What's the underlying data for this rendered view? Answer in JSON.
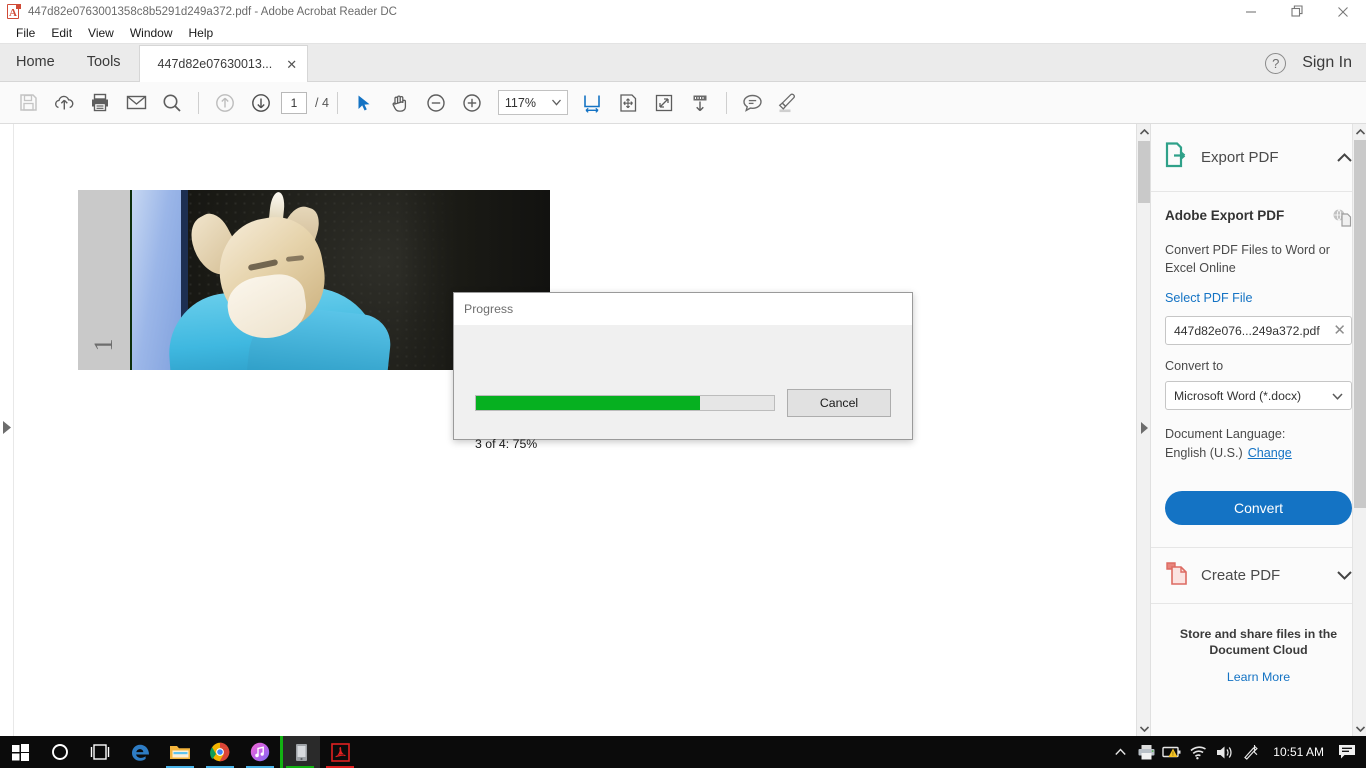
{
  "window": {
    "title": "447d82e0763001358c8b5291d249a372.pdf - Adobe Acrobat Reader DC",
    "minimize_label": "Minimize",
    "restore_label": "Restore",
    "close_label": "Close"
  },
  "menu": {
    "items": [
      "File",
      "Edit",
      "View",
      "Window",
      "Help"
    ]
  },
  "tabs": {
    "home": "Home",
    "tools": "Tools",
    "document": "447d82e07630013...",
    "close_glyph": "✕",
    "help_glyph": "?",
    "sign_in": "Sign In"
  },
  "toolbar": {
    "icons": [
      "save-icon",
      "cloud-upload-icon",
      "print-icon",
      "email-icon",
      "search-icon",
      "previous-page-icon",
      "next-page-icon"
    ],
    "page_current": "1",
    "page_total": "/ 4",
    "select_tool": "select-cursor-icon",
    "hand_tool": "hand-icon",
    "zoom_out": "zoom-out-icon",
    "zoom_in": "zoom-in-icon",
    "zoom_level": "117%",
    "zoom_chevron": "▾",
    "fit_width_icon": "fit-width-icon",
    "pan_zoom_icon": "pan-and-zoom-icon",
    "fullscreen_icon": "fullscreen-icon",
    "scroll_icon": "scroll-down-icon",
    "comment_icon": "comment-icon",
    "highlight_icon": "highlight-pen-icon"
  },
  "document": {
    "page_number": "1"
  },
  "dialog": {
    "title": "Progress",
    "cancel_label": "Cancel",
    "status": "3 of 4: 75%",
    "percent": 75,
    "bar_color": "#06b020"
  },
  "right_panel": {
    "export": {
      "header": "Export PDF",
      "chevron": "⌃",
      "heading": "Adobe Export PDF",
      "description": "Convert PDF Files to Word or Excel Online",
      "select_link": "Select PDF File",
      "file_name": "447d82e076...249a372.pdf",
      "file_clear": "✕",
      "convert_to_label": "Convert to",
      "convert_to_value": "Microsoft Word (*.docx)",
      "select_chevron": "∨",
      "language_label": "Document Language:",
      "language_value": "English (U.S.)",
      "language_change": "Change",
      "convert_button": "Convert",
      "accent_color": "#1473c4"
    },
    "create": {
      "header": "Create PDF",
      "chevron": "∨"
    },
    "cloud": {
      "text_line1": "Store and share files in the",
      "text_line2": "Document Cloud",
      "learn_more": "Learn More"
    }
  },
  "taskbar": {
    "items": [
      "start-windows-icon",
      "cortana-search-icon",
      "task-view-icon",
      "edge-browser-icon",
      "file-explorer-icon",
      "chrome-browser-icon",
      "itunes-icon",
      "app-window-icon",
      "acrobat-reader-icon"
    ],
    "tray": [
      "show-hidden-icons-icon",
      "printer-icon",
      "battery-warning-icon",
      "wifi-icon",
      "volume-icon",
      "pen-bluetooth-icon"
    ],
    "clock": "10:51 AM",
    "notifications": "notification-center-icon"
  }
}
